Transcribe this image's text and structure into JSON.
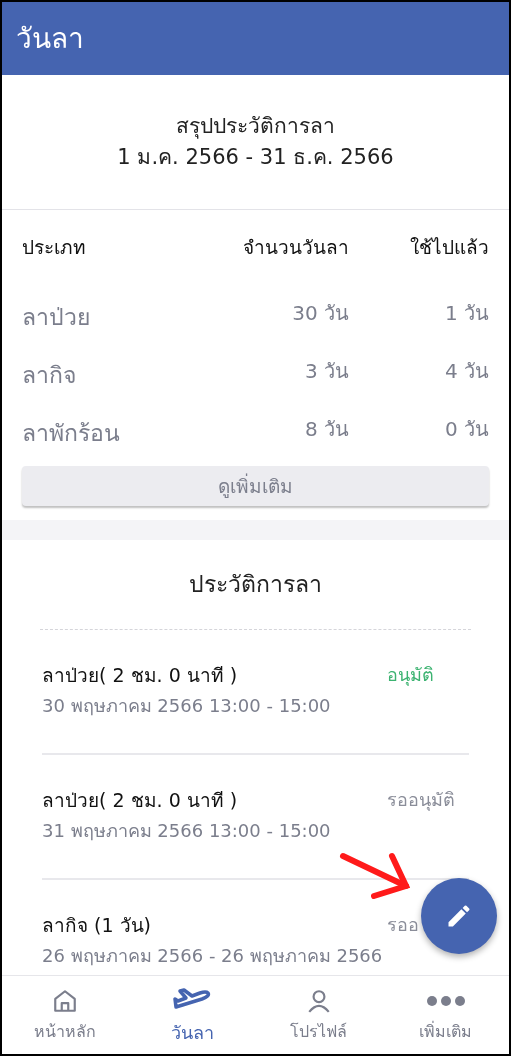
{
  "header": {
    "title": "วันลา"
  },
  "summary": {
    "title": "สรุปประวัติการลา",
    "period": "1 ม.ค. 2566 - 31 ธ.ค. 2566"
  },
  "quota_table": {
    "columns": [
      "ประเภท",
      "จำนวนวันลา",
      "ใช้ไปแล้ว"
    ],
    "rows": [
      {
        "type": "ลาป่วย",
        "quota": "30 วัน",
        "used": "1 วัน"
      },
      {
        "type": "ลากิจ",
        "quota": "3 วัน",
        "used": "4 วัน"
      },
      {
        "type": "ลาพักร้อน",
        "quota": "8 วัน",
        "used": "0 วัน"
      }
    ]
  },
  "more_button": "ดูเพิ่มเติม",
  "history": {
    "title": "ประวัติการลา",
    "items": [
      {
        "title": "ลาป่วย( 2 ชม. 0 นาที )",
        "date": "30 พฤษภาคม 2566 13:00 - 15:00",
        "status": "อนุมัติ",
        "color": "#3cb371"
      },
      {
        "title": "ลาป่วย( 2 ชม. 0 นาที )",
        "date": "31 พฤษภาคม 2566 13:00 - 15:00",
        "status": "รออนุมัติ",
        "color": "#8a8d99"
      },
      {
        "title": "ลากิจ (1 วัน)",
        "date": "26 พฤษภาคม 2566 - 26 พฤษภาคม 2566",
        "status": "รออ",
        "color": "#8a8d99"
      }
    ]
  },
  "bottom_nav": [
    {
      "label": "หน้าหลัก",
      "kind": "home",
      "selected": false
    },
    {
      "label": "วันลา",
      "kind": "plane",
      "selected": true
    },
    {
      "label": "โปรไฟล์",
      "kind": "person",
      "selected": false
    },
    {
      "label": "เพิ่มเติม",
      "kind": "more",
      "selected": false
    }
  ]
}
